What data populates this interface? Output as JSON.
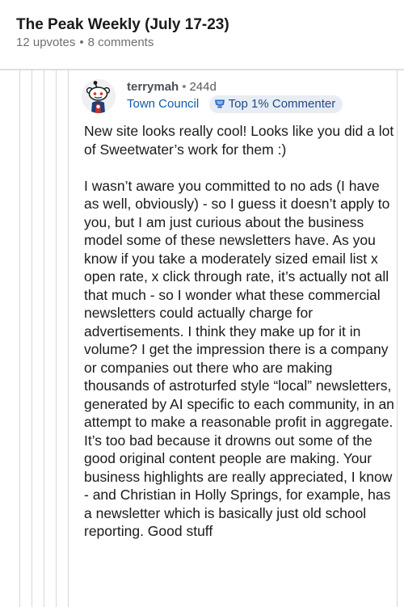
{
  "post": {
    "title": "The Peak Weekly (July 17-23)",
    "upvotes": "12 upvotes",
    "separator": "•",
    "comments": "8 comments"
  },
  "comment": {
    "username": "terrymah",
    "separator": "•",
    "age": "244d",
    "flair": "Town Council",
    "badge_label": "Top 1% Commenter",
    "paragraphs": [
      "New site looks really cool! Looks like you did a lot of Sweetwater’s work for them :)",
      "I wasn’t aware you committed to no ads (I have as well, obviously) - so I guess it doesn’t apply to you, but I am just curious about the business model some of these newsletters have. As you know if you take a moderately sized email list x open rate, x click through rate, it’s actually not all that much - so I wonder what these commercial newsletters could actually charge for advertisements. I think they make up for it in volume? I get the impression there is a company or companies out there who are making thousands of astroturfed style “local” newsletters, generated by AI specific to each community, in an attempt to make a reasonable profit in aggregate. It’s too bad because it drowns out some of the good original content people are making. Your business highlights are really appreciated, I know - and Christian in Holly Springs, for example, has a newsletter which is basically just old school reporting. Good stuff"
    ]
  },
  "icons": {
    "avatar": "snoo-avatar-icon",
    "badge": "trophy-badge-icon"
  },
  "colors": {
    "flair_text": "#0f5aa8",
    "badge_bg": "#e8ecf4",
    "thread_line": "#d6d8db",
    "meta_text": "#6b6f73"
  }
}
